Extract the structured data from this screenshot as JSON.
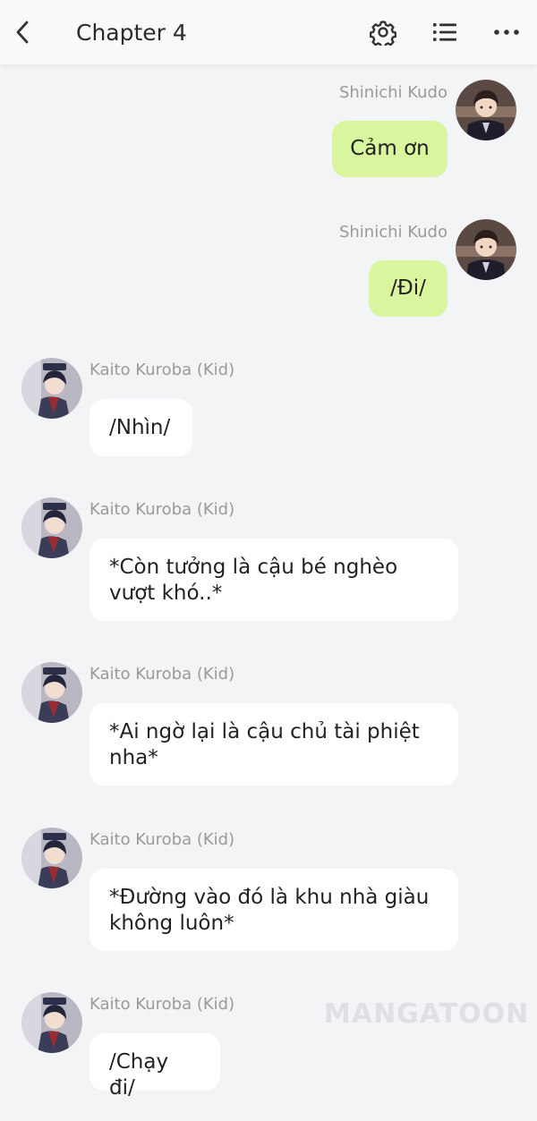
{
  "header": {
    "title": "Chapter 4",
    "back_icon": "chevron-left-icon",
    "settings_icon": "gear-icon",
    "list_icon": "list-icon",
    "more_icon": "ellipsis-icon"
  },
  "messages": [
    {
      "side": "right",
      "name": "Shinichi Kudo",
      "text": "Cảm ơn"
    },
    {
      "side": "right",
      "name": "Shinichi Kudo",
      "text": "/Đi/"
    },
    {
      "side": "left",
      "name": "Kaito Kuroba (Kid)",
      "text": "/Nhìn/"
    },
    {
      "side": "left",
      "name": "Kaito Kuroba (Kid)",
      "text": "*Còn tưởng là cậu bé nghèo vượt khó..*"
    },
    {
      "side": "left",
      "name": "Kaito Kuroba (Kid)",
      "text": "*Ai ngờ lại là cậu chủ tài phiệt nha*"
    },
    {
      "side": "left",
      "name": "Kaito Kuroba (Kid)",
      "text": "*Đường vào đó là khu nhà giàu không luôn*"
    },
    {
      "side": "left",
      "name": "Kaito Kuroba (Kid)",
      "text": "/Chạy đi/"
    }
  ],
  "watermark": "MANGATOON",
  "colors": {
    "right_bubble": "#d9f59d",
    "left_bubble": "#ffffff",
    "background": "#f3f4f6"
  }
}
